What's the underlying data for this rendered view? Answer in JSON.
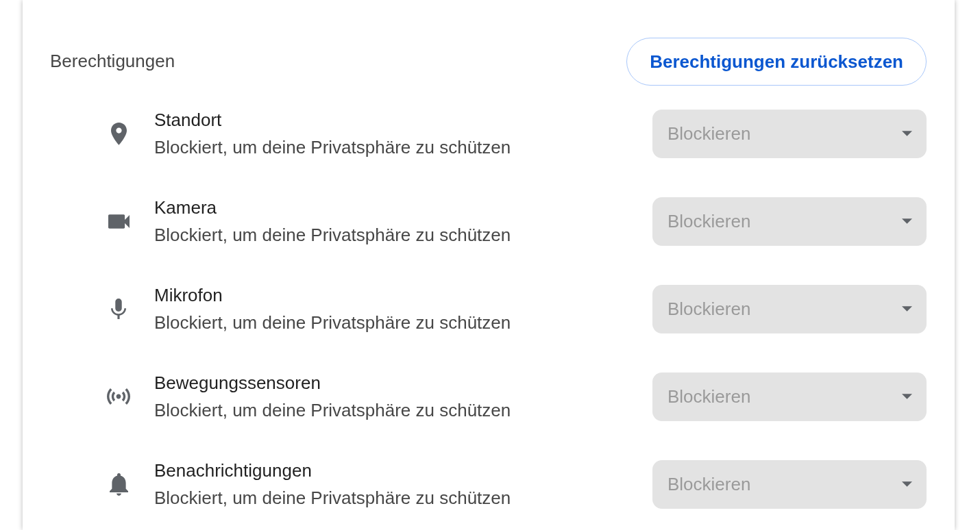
{
  "section": {
    "title": "Berechtigungen",
    "reset_button": "Berechtigungen zurücksetzen"
  },
  "permissions": [
    {
      "kind": "location",
      "name": "Standort",
      "description": "Blockiert, um deine Privatsphäre zu schützen",
      "setting": "Blockieren",
      "disabled": true
    },
    {
      "kind": "camera",
      "name": "Kamera",
      "description": "Blockiert, um deine Privatsphäre zu schützen",
      "setting": "Blockieren",
      "disabled": true
    },
    {
      "kind": "microphone",
      "name": "Mikrofon",
      "description": "Blockiert, um deine Privatsphäre zu schützen",
      "setting": "Blockieren",
      "disabled": true
    },
    {
      "kind": "sensors",
      "name": "Bewegungssensoren",
      "description": "Blockiert, um deine Privatsphäre zu schützen",
      "setting": "Blockieren",
      "disabled": true
    },
    {
      "kind": "notifications",
      "name": "Benachrichtigungen",
      "description": "Blockiert, um deine Privatsphäre zu schützen",
      "setting": "Blockieren",
      "disabled": true
    }
  ]
}
